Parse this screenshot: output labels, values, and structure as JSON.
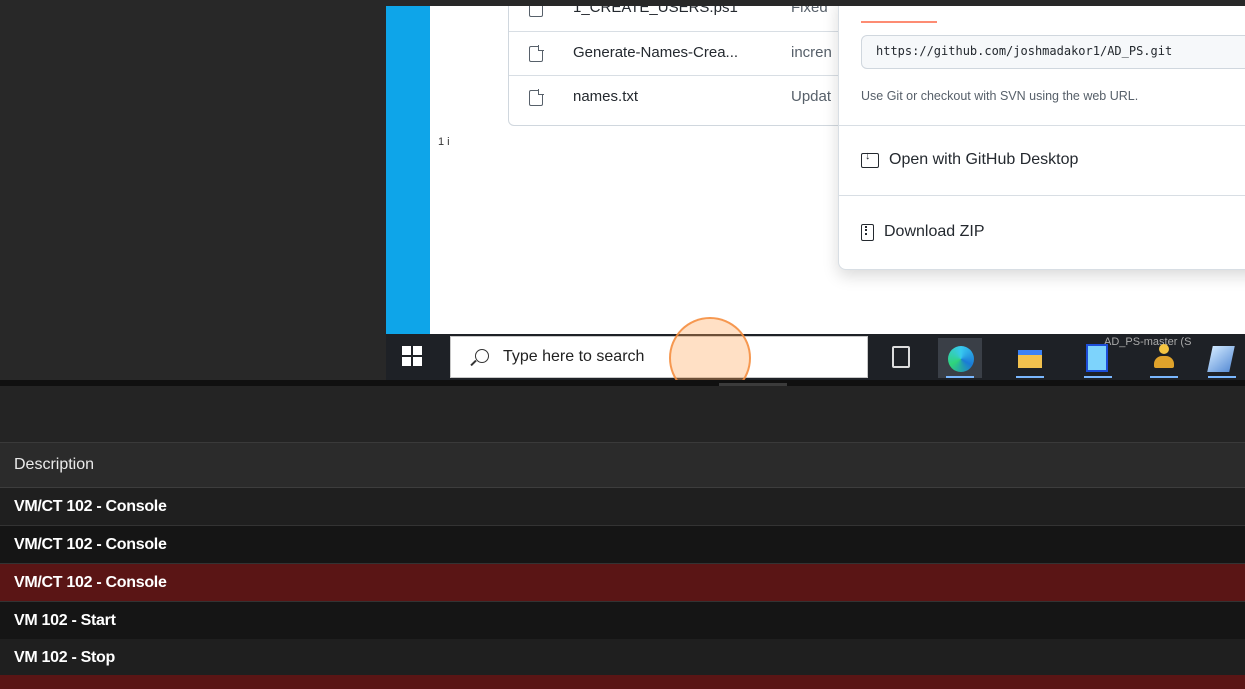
{
  "vm_console": {
    "page_fragment": "1 i",
    "file_list": [
      {
        "name": "1_CREATE_USERS.ps1",
        "commit": "Fixed"
      },
      {
        "name": "Generate-Names-Crea...",
        "commit": "incren"
      },
      {
        "name": "names.txt",
        "commit": "Updat"
      }
    ],
    "clone_dropdown": {
      "url": "https://github.com/joshmadakor1/AD_PS.git",
      "help_text": "Use Git or checkout with SVN using the web URL.",
      "open_desktop_label": "Open with GitHub Desktop",
      "download_zip_label": "Download ZIP"
    },
    "taskbar": {
      "search_placeholder": "Type here to search",
      "tooltip_fragment": "AD_PS-master (S",
      "accent_color": "#7ab7ff"
    }
  },
  "task_log": {
    "column_header": "Description",
    "rows": [
      {
        "description": "VM/CT 102 - Console",
        "status": "ok"
      },
      {
        "description": "VM/CT 102 - Console",
        "status": "ok"
      },
      {
        "description": "VM/CT 102 - Console",
        "status": "error"
      },
      {
        "description": "VM 102 - Start",
        "status": "ok"
      },
      {
        "description": "VM 102 - Stop",
        "status": "ok"
      }
    ],
    "error_color": "#5a1515"
  }
}
